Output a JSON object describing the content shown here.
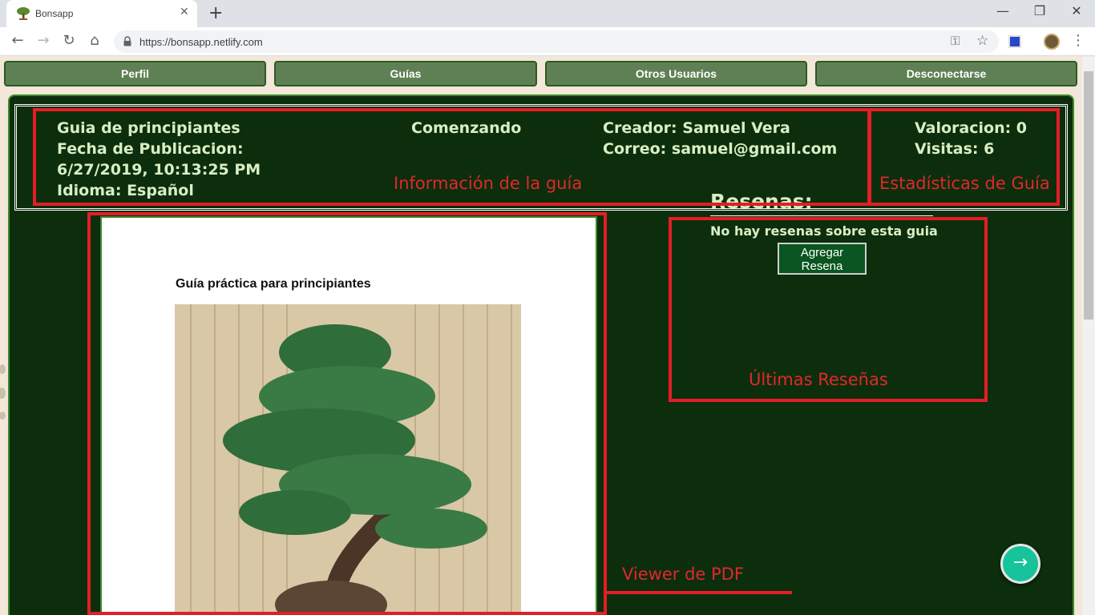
{
  "browser": {
    "tab_title": "Bonsapp",
    "tab_close": "✕",
    "new_tab": "+",
    "url": "https://bonsapp.netlify.com",
    "window_controls": {
      "minimize": "—",
      "restore": "❐",
      "close": "✕"
    },
    "nav": {
      "back": "←",
      "forward": "→",
      "reload": "↻",
      "home": "⌂"
    },
    "icons": {
      "key": "⚿",
      "star": "☆",
      "menu": "⋮"
    }
  },
  "nav_buttons": [
    "Perfil",
    "Guías",
    "Otros Usuarios",
    "Desconectarse"
  ],
  "guide": {
    "title": "Guia de principiantes",
    "date_label": "Fecha de Publicacion:",
    "date_value": "6/27/2019, 10:13:25 PM",
    "language": "Idioma: Español",
    "category": "Comenzando",
    "creator": "Creador: Samuel Vera",
    "email": "Correo: samuel@gmail.com",
    "rating": "Valoracion: 0",
    "visits": "Visitas: 6"
  },
  "annotations": {
    "info": "Información de la guía",
    "stats": "Estadísticas de Guía",
    "reviews": "Últimas Reseñas",
    "viewer": "Viewer de PDF"
  },
  "pdf": {
    "title": "Guía práctica para principiantes"
  },
  "reviews": {
    "heading": "Resenas:",
    "empty_text": "No hay resenas sobre esta guia",
    "add_line1": "Agregar",
    "add_line2": "Resena"
  },
  "fab_arrow": "→",
  "colors": {
    "panel_bg": "#0d2e0c",
    "nav_button": "#5f8055",
    "annotation_red": "#e21e28",
    "text_light_green": "#d8eec4",
    "fab": "#17c39a",
    "page_bg": "#f2e7d9"
  }
}
